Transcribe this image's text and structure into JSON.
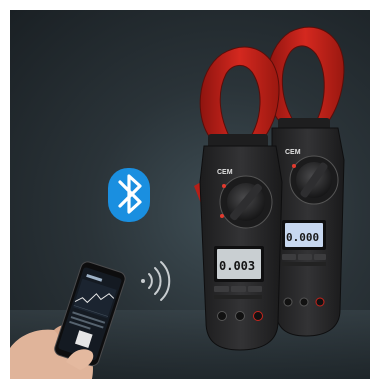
{
  "photo": {
    "subject": "clamp meters with bluetooth smartphone app",
    "icons": [
      "bluetooth-icon",
      "wireless-signal-icon"
    ],
    "colors": {
      "background": "#2a3338",
      "clamp_red": "#c8241c",
      "meter_body": "#2b2b2c",
      "bluetooth_blue": "#1a8fe0",
      "lcd_front": "#c9cfd2",
      "lcd_back": "#c8d8f0"
    }
  },
  "front_meter": {
    "brand": "CEM",
    "lcd_value": "0.003"
  },
  "back_meter": {
    "brand": "CEM",
    "lcd_value": "0.000"
  }
}
